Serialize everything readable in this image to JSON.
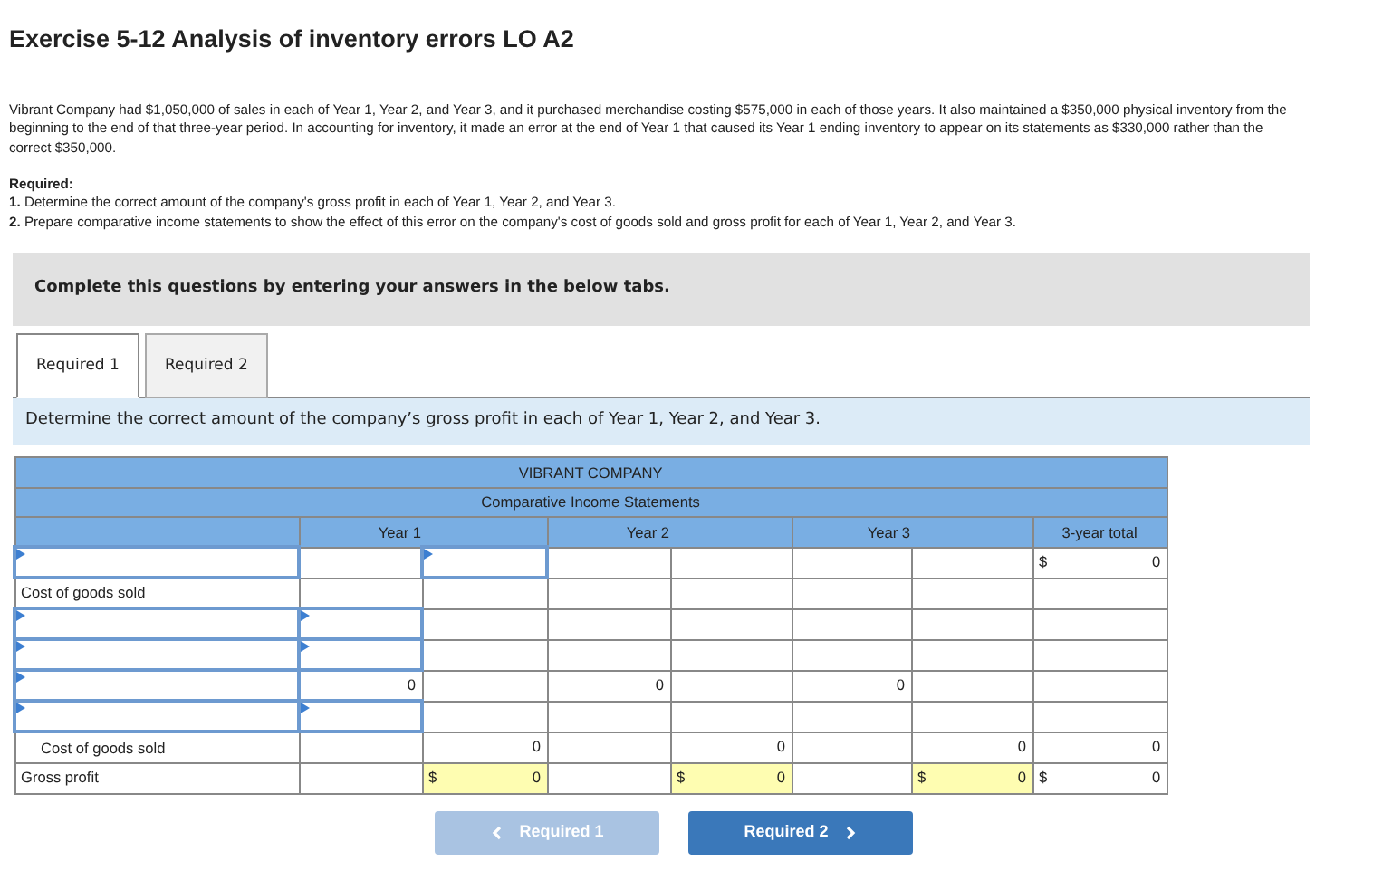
{
  "title": "Exercise 5-12 Analysis of inventory errors LO A2",
  "description": "Vibrant Company had $1,050,000 of sales in each of Year 1, Year 2, and Year 3, and it purchased merchandise costing $575,000 in each of those years. It also maintained a $350,000 physical inventory from the beginning to the end of that three-year period. In accounting for inventory, it made an error at the end of Year 1 that caused its Year 1 ending inventory to appear on its statements as $330,000 rather than the correct $350,000.",
  "required_heading": "Required:",
  "required_items": [
    "**1.** Determine the correct amount of the company's gross profit in each of Year 1, Year 2, and Year 3.",
    "**2.** Prepare comparative income statements to show the effect of this error on the company's cost of goods sold and gross profit for each of Year 1, Year 2, and Year 3."
  ],
  "instruction": "Complete this questions by entering your answers in the below tabs.",
  "tabs": [
    {
      "label": "Required 1",
      "selected": true
    },
    {
      "label": "Required 2",
      "selected": false
    }
  ],
  "prompt": "Determine the correct amount of the company’s gross profit in each of Year 1, Year 2, and Year 3.",
  "table": {
    "company": "VIBRANT COMPANY",
    "statement": "Comparative Income Statements",
    "columns": [
      "",
      "Year 1",
      "",
      "Year 2",
      "",
      "Year 3",
      "",
      "3-year total"
    ],
    "rows": [
      [
        {
          "kind": "input"
        },
        {
          "kind": "blank"
        },
        {
          "kind": "input"
        },
        {
          "kind": "blank"
        },
        {
          "kind": "blank"
        },
        {
          "kind": "blank"
        },
        {
          "kind": "blank"
        },
        {
          "kind": "money",
          "prefix": "$",
          "value": "0"
        }
      ],
      [
        {
          "kind": "label",
          "text": "Cost of goods sold"
        },
        {
          "kind": "blank"
        },
        {
          "kind": "blank"
        },
        {
          "kind": "blank"
        },
        {
          "kind": "blank"
        },
        {
          "kind": "blank"
        },
        {
          "kind": "blank"
        },
        {
          "kind": "blank"
        }
      ],
      [
        {
          "kind": "input"
        },
        {
          "kind": "input"
        },
        {
          "kind": "blank"
        },
        {
          "kind": "blank"
        },
        {
          "kind": "blank"
        },
        {
          "kind": "blank"
        },
        {
          "kind": "blank"
        },
        {
          "kind": "blank"
        }
      ],
      [
        {
          "kind": "input"
        },
        {
          "kind": "input"
        },
        {
          "kind": "blank"
        },
        {
          "kind": "blank"
        },
        {
          "kind": "blank"
        },
        {
          "kind": "blank"
        },
        {
          "kind": "blank"
        },
        {
          "kind": "blank"
        }
      ],
      [
        {
          "kind": "input"
        },
        {
          "kind": "value",
          "value": "0"
        },
        {
          "kind": "blank"
        },
        {
          "kind": "value",
          "value": "0"
        },
        {
          "kind": "blank"
        },
        {
          "kind": "value",
          "value": "0"
        },
        {
          "kind": "blank"
        },
        {
          "kind": "blank"
        }
      ],
      [
        {
          "kind": "input"
        },
        {
          "kind": "input"
        },
        {
          "kind": "blank"
        },
        {
          "kind": "blank"
        },
        {
          "kind": "blank"
        },
        {
          "kind": "blank"
        },
        {
          "kind": "blank"
        },
        {
          "kind": "blank"
        }
      ],
      [
        {
          "kind": "sublabel",
          "text": "Cost of goods sold"
        },
        {
          "kind": "blank"
        },
        {
          "kind": "value",
          "value": "0"
        },
        {
          "kind": "blank"
        },
        {
          "kind": "value",
          "value": "0"
        },
        {
          "kind": "blank"
        },
        {
          "kind": "value",
          "value": "0"
        },
        {
          "kind": "value",
          "value": "0"
        }
      ],
      [
        {
          "kind": "label",
          "text": "Gross profit"
        },
        {
          "kind": "blank"
        },
        {
          "kind": "answer",
          "prefix": "$",
          "value": "0"
        },
        {
          "kind": "blank"
        },
        {
          "kind": "answer",
          "prefix": "$",
          "value": "0"
        },
        {
          "kind": "blank"
        },
        {
          "kind": "answer",
          "prefix": "$",
          "value": "0"
        },
        {
          "kind": "money",
          "prefix": "$",
          "value": "0"
        }
      ]
    ]
  },
  "nav_buttons": [
    {
      "label": "Required 1",
      "kind": "prev",
      "disabled": true
    },
    {
      "label": "Required 2",
      "kind": "next",
      "disabled": false
    }
  ]
}
